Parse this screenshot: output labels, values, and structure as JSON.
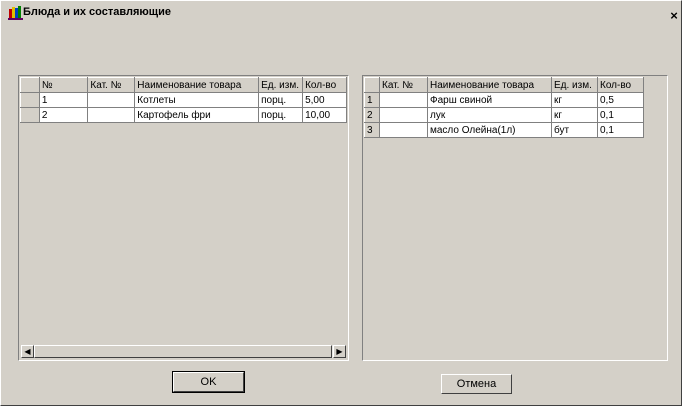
{
  "window": {
    "title": "Блюда и их составляющие",
    "close_glyph": "×"
  },
  "dishes_grid": {
    "columns": [
      "№",
      "Кат. №",
      "Наименование товара",
      "Ед. изм.",
      "Кол-во"
    ],
    "rows": [
      {
        "num": "1",
        "cat": "",
        "name": "Котлеты",
        "unit": "порц.",
        "qty": "5,00"
      },
      {
        "num": "2",
        "cat": "",
        "name": "Картофель фри",
        "unit": "порц.",
        "qty": "10,00"
      }
    ]
  },
  "components_grid": {
    "columns": [
      "Кат. №",
      "Наименование товара",
      "Ед. изм.",
      "Кол-во"
    ],
    "rows": [
      {
        "index": "1",
        "cat": "",
        "name": "Фарш свиной",
        "unit": "кг",
        "qty": "0,5"
      },
      {
        "index": "2",
        "cat": "",
        "name": "лук",
        "unit": "кг",
        "qty": "0,1"
      },
      {
        "index": "3",
        "cat": "",
        "name": "масло Олейна(1л)",
        "unit": "бут",
        "qty": "0,1"
      }
    ]
  },
  "buttons": {
    "ok_label": "OK",
    "cancel_label": "Отмена"
  },
  "scroll": {
    "left_arrow": "◀",
    "right_arrow": "▶"
  }
}
